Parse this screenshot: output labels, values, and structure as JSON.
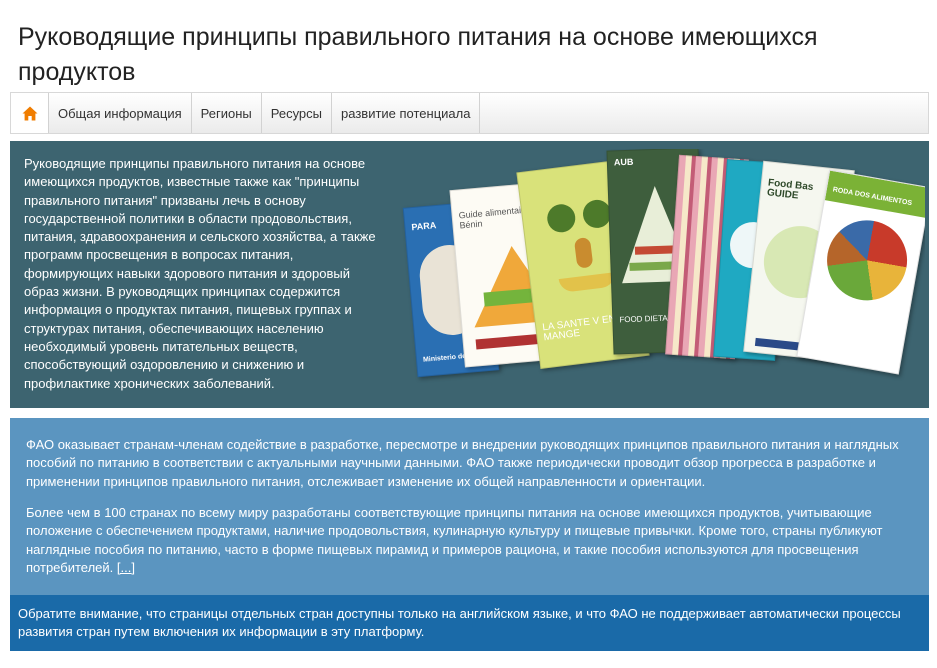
{
  "page": {
    "title": "Руководящие принципы правильного питания на основе имеющихся продуктов"
  },
  "nav": {
    "home_icon": "home-icon",
    "accent_color": "#f07d00",
    "items": [
      {
        "label": "Общая информация"
      },
      {
        "label": "Регионы"
      },
      {
        "label": "Ресурсы"
      },
      {
        "label": "развитие потенциала"
      }
    ]
  },
  "hero": {
    "text": "Руководящие принципы правильного питания на основе имеющихся продуктов, известные также как \"принципы правильного питания\" призваны лечь в основу государственной политики в области продовольствия, питания, здравоохранения и сельского хозяйства, а также программ просвещения в вопросах питания, формирующих навыки здорового питания и здоровый образ жизни. В руководящих принципах содержится информация о продуктах питания, пищевых группах и структурах питания, обеспечивающих населению необходимый уровень питательных веществ, способствующий оздоровлению и снижению и профилактике хронических заболеваний.",
    "background": "#3d6470",
    "image": {
      "book_titles": [
        "PARA",
        "Guide alimentaire du Bénin",
        "LA SANTE V EN MANGE",
        "FOOD DIETARY G",
        "Food Bas GUIDE",
        "RODA DOS ALIMENTOS"
      ],
      "logo_texts": [
        "Ministerio de SALUD",
        "AUB"
      ]
    }
  },
  "info": {
    "paragraph1": "ФАО оказывает странам-членам содействие в разработке, пересмотре и внедрении руководящих принципов правильного питания и наглядных пособий по питанию в соответствии с актуальными научными данными. ФАО также периодически проводит обзор прогресса в разработке и применении принципов правильного питания, отслеживает изменение их общей направленности и ориентации.",
    "paragraph2": "Более чем в 100 странах по всему миру разработаны соответствующие принципы питания на основе имеющихся продуктов, учитывающие положение с обеспечением продуктами, наличие продовольствия, кулинарную культуру и пищевые привычки. Кроме того, страны публикуют наглядные пособия по питанию, часто в форме пищевых пирамид и примеров рациона, и такие пособия используются для просвещения потребителей.",
    "more_link": "[...]",
    "background": "#5b95c0"
  },
  "notice": {
    "text": "Обратите внимание, что страницы отдельных стран доступны только на английском языке, и что ФАО не поддерживает автоматически процессы развития стран путем включения их информации в эту платформу.",
    "background": "#1a6aa8"
  }
}
